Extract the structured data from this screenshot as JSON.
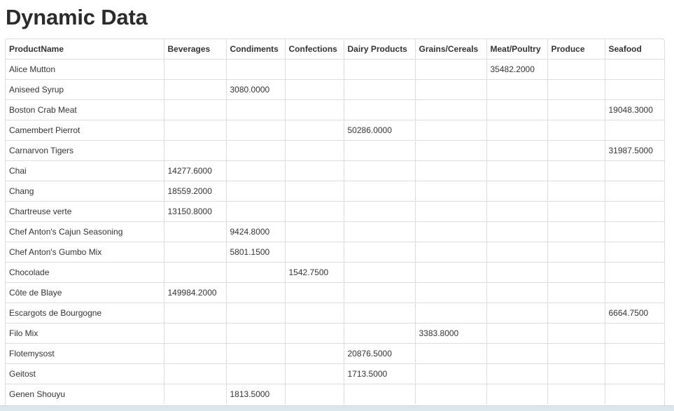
{
  "page": {
    "title": "Dynamic Data"
  },
  "table": {
    "columns": [
      "ProductName",
      "Beverages",
      "Condiments",
      "Confections",
      "Dairy Products",
      "Grains/Cereals",
      "Meat/Poultry",
      "Produce",
      "Seafood"
    ],
    "rows": [
      [
        "Alice Mutton",
        "",
        "",
        "",
        "",
        "",
        "35482.2000",
        "",
        ""
      ],
      [
        "Aniseed Syrup",
        "",
        "3080.0000",
        "",
        "",
        "",
        "",
        "",
        ""
      ],
      [
        "Boston Crab Meat",
        "",
        "",
        "",
        "",
        "",
        "",
        "",
        "19048.3000"
      ],
      [
        "Camembert Pierrot",
        "",
        "",
        "",
        "50286.0000",
        "",
        "",
        "",
        ""
      ],
      [
        "Carnarvon Tigers",
        "",
        "",
        "",
        "",
        "",
        "",
        "",
        "31987.5000"
      ],
      [
        "Chai",
        "14277.6000",
        "",
        "",
        "",
        "",
        "",
        "",
        ""
      ],
      [
        "Chang",
        "18559.2000",
        "",
        "",
        "",
        "",
        "",
        "",
        ""
      ],
      [
        "Chartreuse verte",
        "13150.8000",
        "",
        "",
        "",
        "",
        "",
        "",
        ""
      ],
      [
        "Chef Anton's Cajun Seasoning",
        "",
        "9424.8000",
        "",
        "",
        "",
        "",
        "",
        ""
      ],
      [
        "Chef Anton's Gumbo Mix",
        "",
        "5801.1500",
        "",
        "",
        "",
        "",
        "",
        ""
      ],
      [
        "Chocolade",
        "",
        "",
        "1542.7500",
        "",
        "",
        "",
        "",
        ""
      ],
      [
        "Côte de Blaye",
        "149984.2000",
        "",
        "",
        "",
        "",
        "",
        "",
        ""
      ],
      [
        "Escargots de Bourgogne",
        "",
        "",
        "",
        "",
        "",
        "",
        "",
        "6664.7500"
      ],
      [
        "Filo Mix",
        "",
        "",
        "",
        "",
        "3383.8000",
        "",
        "",
        ""
      ],
      [
        "Flotemysost",
        "",
        "",
        "",
        "20876.5000",
        "",
        "",
        "",
        ""
      ],
      [
        "Geitost",
        "",
        "",
        "",
        "1713.5000",
        "",
        "",
        "",
        ""
      ],
      [
        "Genen Shouyu",
        "",
        "1813.5000",
        "",
        "",
        "",
        "",
        "",
        ""
      ]
    ]
  }
}
